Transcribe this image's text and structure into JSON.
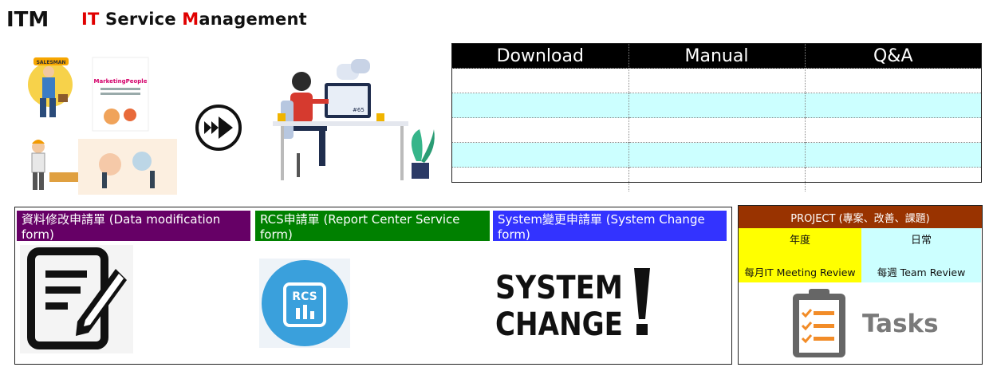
{
  "header": {
    "title": "ITM",
    "subtitle": {
      "it_letters": "IT",
      "service": " Service ",
      "m_letter": "M",
      "rest": "anagement"
    }
  },
  "illustrations": {
    "salesman_badge": "SALESMAN",
    "marketing_label": "MarketingPeople",
    "monitor_tag": "#65"
  },
  "doc_table": {
    "columns": [
      "Download",
      "Manual",
      "Q&A"
    ],
    "rows": 5
  },
  "forms": {
    "data_modification": "資料修改申請單 (Data modification form)",
    "rcs": "RCS申請單 (Report Center Service form)",
    "system_change": "System變更申請單 (System Change form)",
    "rcs_logo_text": "RCS",
    "system_change_line1": "SYSTEM",
    "system_change_line2": "CHANGE"
  },
  "project": {
    "header": "PROJECT (專案、改善、課題)",
    "yearly_label": "年度",
    "yearly_item": "每月IT Meeting Review",
    "daily_label": "日常",
    "daily_item": "每週 Team Review",
    "tasks_label": "Tasks"
  },
  "colors": {
    "accent_red": "#e00000",
    "data_tab": "#660066",
    "rcs_tab": "#008000",
    "system_tab": "#3333ff",
    "project_header": "#993300",
    "yearly_bg": "#ffff00",
    "daily_bg": "#ccffff",
    "table_alt_row": "#ccffff"
  }
}
